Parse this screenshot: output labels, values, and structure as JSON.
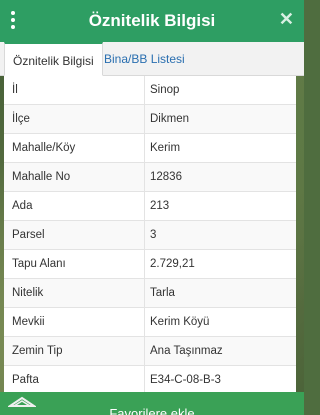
{
  "header": {
    "title": "Öznitelik Bilgisi"
  },
  "tabs": [
    {
      "label": "Öznitelik Bilgisi"
    },
    {
      "label": "Bina/BB Listesi"
    }
  ],
  "rows": [
    {
      "label": "İl",
      "value": "Sinop"
    },
    {
      "label": "İlçe",
      "value": "Dikmen"
    },
    {
      "label": "Mahalle/Köy",
      "value": "Kerim"
    },
    {
      "label": "Mahalle No",
      "value": "12836"
    },
    {
      "label": "Ada",
      "value": "213"
    },
    {
      "label": "Parsel",
      "value": "3"
    },
    {
      "label": "Tapu Alanı",
      "value": "2.729,21"
    },
    {
      "label": "Nitelik",
      "value": "Tarla"
    },
    {
      "label": "Mevkii",
      "value": "Kerim Köyü"
    },
    {
      "label": "Zemin Tip",
      "value": "Ana Taşınmaz"
    },
    {
      "label": "Pafta",
      "value": "E34-C-08-B-3"
    }
  ],
  "footer": {
    "button_label": "Favorilere ekle"
  },
  "colors": {
    "accent": "#2e9e63",
    "link": "#2a6fb0"
  }
}
